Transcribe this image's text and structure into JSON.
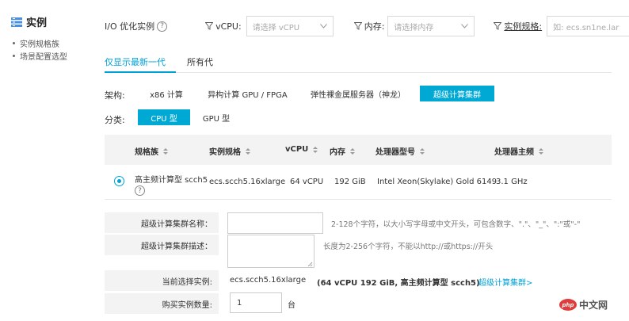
{
  "sidebar": {
    "title": "实例",
    "items": [
      {
        "label": "实例规格族"
      },
      {
        "label": "场景配置选型"
      }
    ]
  },
  "filters": {
    "io_label": "I/O 优化实例",
    "vcpu_label": "vCPU:",
    "vcpu_placeholder": "请选择 vCPU",
    "memory_label": "内存:",
    "memory_placeholder": "请选择内存",
    "spec_label": "实例规格:",
    "spec_placeholder": "如: ecs.sn1ne.lar"
  },
  "tabs": [
    {
      "label": "仅显示最新一代",
      "active": true
    },
    {
      "label": "所有代",
      "active": false
    }
  ],
  "architecture": {
    "label": "架构:",
    "options": [
      {
        "label": "x86 计算",
        "active": false
      },
      {
        "label": "异构计算 GPU / FPGA",
        "active": false
      },
      {
        "label": "弹性裸金属服务器（神龙）",
        "active": false
      },
      {
        "label": "超级计算集群",
        "active": true
      }
    ]
  },
  "category": {
    "label": "分类:",
    "options": [
      {
        "label": "CPU 型",
        "active": true
      },
      {
        "label": "GPU 型",
        "active": false
      }
    ]
  },
  "table": {
    "columns": [
      "规格族",
      "实例规格",
      "vCPU",
      "内存",
      "处理器型号",
      "处理器主频"
    ],
    "rows": [
      {
        "selected": true,
        "family": "高主频计算型 scch5",
        "spec": "ecs.scch5.16xlarge",
        "vcpu": "64 vCPU",
        "memory": "192 GiB",
        "processor": "Intel Xeon(Skylake) Gold 6149",
        "frequency": "3.1 GHz"
      }
    ]
  },
  "form": {
    "cluster_name_label": "超级计算集群名称：",
    "cluster_name_value": "",
    "cluster_name_hint": "2-128个字符，以大小写字母或中文开头，可包含数字、\".\"、\"_\"、\":\"或\"-\"",
    "cluster_desc_label": "超级计算集群描述：",
    "cluster_desc_value": "",
    "cluster_desc_hint": "长度为2-256个字符，不能以http://或https://开头",
    "current_label": "当前选择实例:",
    "current_spec": "ecs.scch5.16xlarge",
    "current_detail": "(64 vCPU 192 GiB, 高主频计算型 scch5)",
    "current_link": "超级计算集群>",
    "quantity_label": "购买实例数量:",
    "quantity_value": "1",
    "quantity_unit": "台"
  },
  "watermark": {
    "logo_text": "php",
    "text": "中文网"
  },
  "colors": {
    "accent": "#00a1d6",
    "active_button": "#00a8d4",
    "label_bg": "#f3f3f3"
  }
}
